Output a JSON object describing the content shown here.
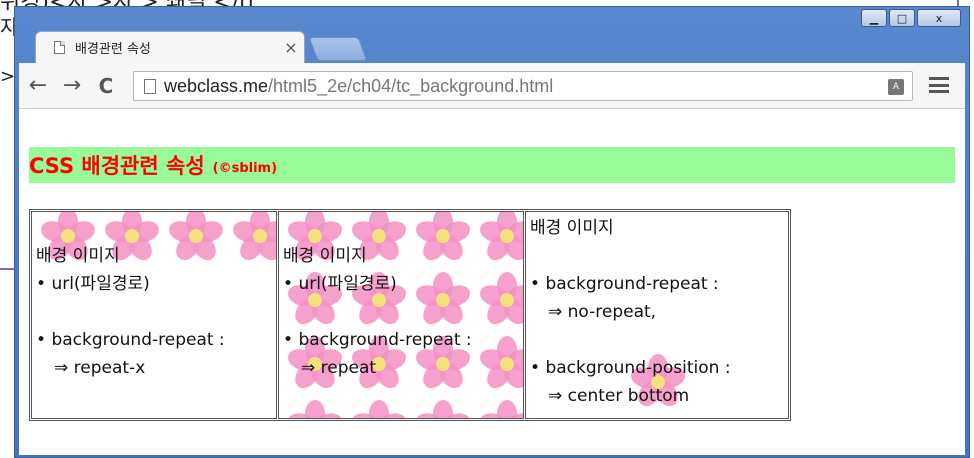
{
  "background_fragments": {
    "line1": "위경)<자 >자 >   쇄렬   </ti",
    "line2": "자",
    "line3": ">"
  },
  "window": {
    "controls": {
      "minimize": "▁",
      "maximize": "□",
      "close": "x"
    }
  },
  "tab": {
    "title": "배경관련 속성",
    "close": "×"
  },
  "toolbar": {
    "back": "←",
    "forward": "→",
    "reload": "C",
    "url_host": "webclass.me",
    "url_path": "/html5_2e/ch04/tc_background.html",
    "translate_icon": "translate-icon",
    "menu_icon": "menu-icon"
  },
  "page": {
    "heading": "CSS 배경관련 속성",
    "heading_small": "(©sblim)",
    "cells": [
      {
        "title": "배경 이미지",
        "lines": [
          "url(파일경로)",
          "background-repeat :",
          "⇒ repeat-x"
        ],
        "repeat": "repeat-x"
      },
      {
        "title": "배경 이미지",
        "lines": [
          "url(파일경로)",
          "background-repeat :",
          "⇒ repeat"
        ],
        "repeat": "repeat"
      },
      {
        "title": "배경 이미지",
        "lines": [
          "background-repeat :",
          "⇒ no-repeat,",
          "background-position :",
          "⇒ center bottom"
        ],
        "repeat": "no-repeat"
      }
    ]
  },
  "colors": {
    "heading_bg": "#98fb98",
    "heading_text": "#ff0000",
    "flower_pink": "#f58fc6",
    "flower_center": "#f6e27a"
  }
}
